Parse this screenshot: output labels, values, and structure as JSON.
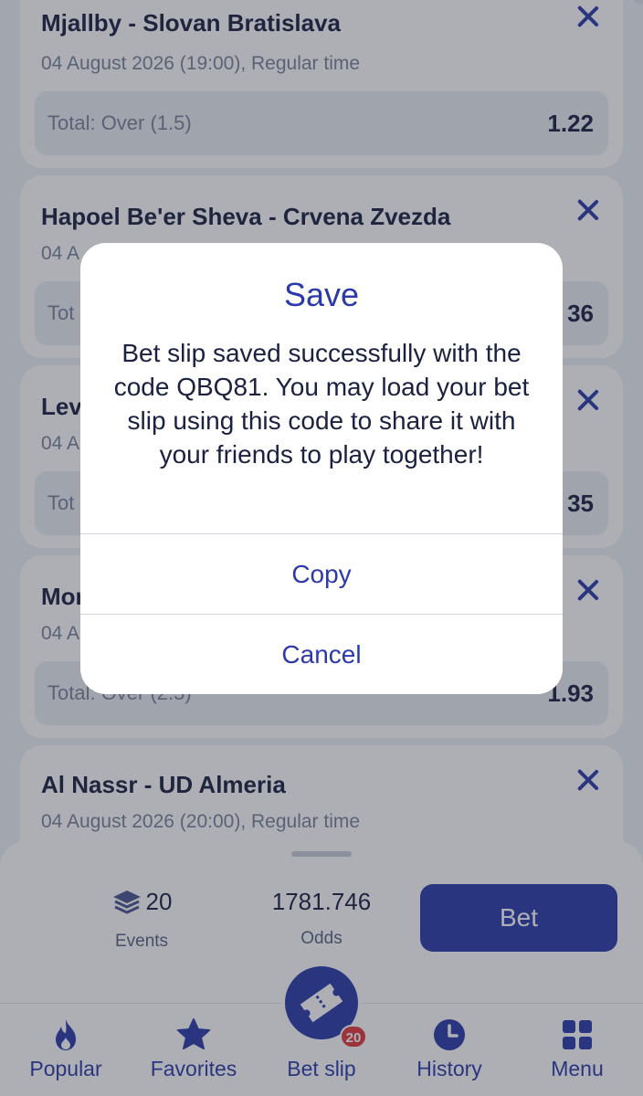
{
  "events": [
    {
      "title": "Mjallby - Slovan Bratislava",
      "datetime": "04 August 2026 (19:00), Regular time",
      "market": "Total: Over (1.5)",
      "odds": "1.22"
    },
    {
      "title": "Hapoel Be'er Sheva - Crvena Zvezda",
      "datetime": "04 A",
      "market": "Tot",
      "odds": "36"
    },
    {
      "title": "Lev",
      "datetime": "04 A",
      "market": "Tot",
      "odds": "35"
    },
    {
      "title": "Mor",
      "datetime": "04 A",
      "market": "Total: Over (2.5)",
      "odds": "1.93"
    },
    {
      "title": "Al Nassr - UD Almeria",
      "datetime": "04 August 2026 (20:00), Regular time"
    }
  ],
  "summary": {
    "events_count": "20",
    "events_label": "Events",
    "odds_value": "1781.746",
    "odds_label": "Odds",
    "bet_label": "Bet"
  },
  "nav": {
    "items": [
      {
        "label": "Popular",
        "icon": "flame-icon"
      },
      {
        "label": "Favorites",
        "icon": "star-icon"
      },
      {
        "label": "Bet slip",
        "icon": "ticket-icon"
      },
      {
        "label": "History",
        "icon": "clock-icon"
      },
      {
        "label": "Menu",
        "icon": "grid-icon"
      }
    ],
    "betslip_badge": "20"
  },
  "dialog": {
    "title": "Save",
    "message": "Bet slip saved successfully with the code QBQ81. You may load your bet slip using this code to share it with your friends to play together!",
    "copy_label": "Copy",
    "cancel_label": "Cancel"
  },
  "colors": {
    "accent": "#2b3aa8",
    "badge": "#e23a3a",
    "background": "#eef1f5"
  }
}
